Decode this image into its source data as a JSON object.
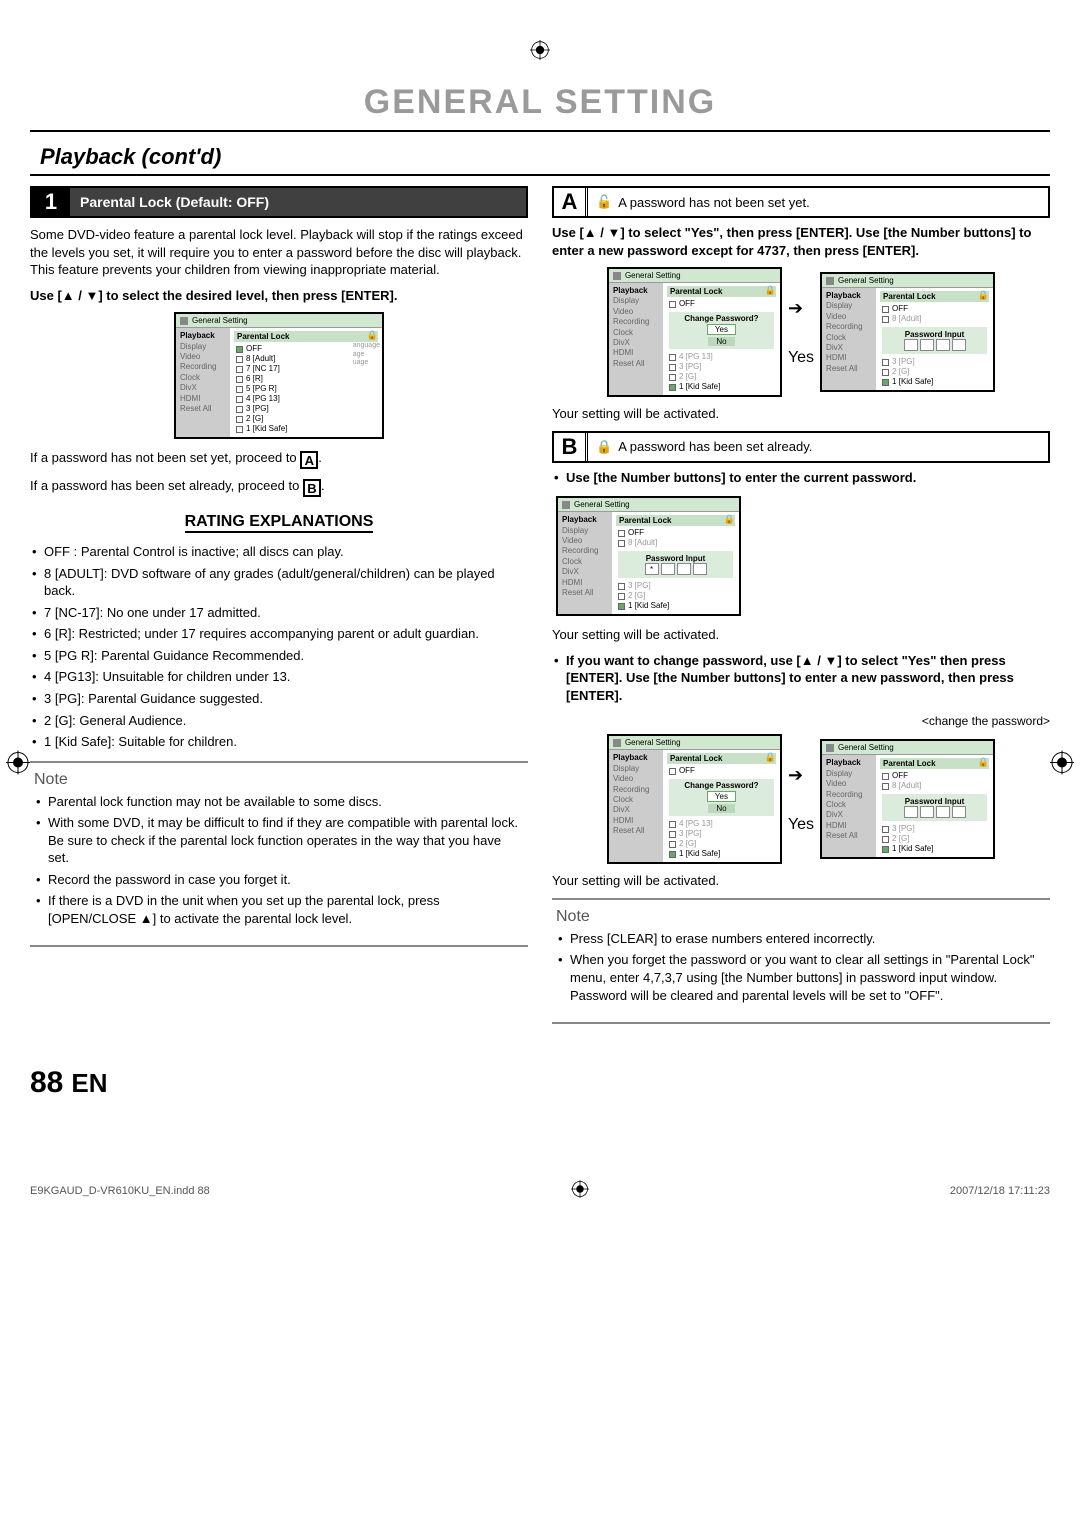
{
  "page": {
    "title": "GENERAL SETTING",
    "section": "Playback (cont'd)",
    "page_number": "88",
    "lang": "EN"
  },
  "step1": {
    "num": "1",
    "title": "Parental Lock (Default: OFF)",
    "intro": "Some DVD-video feature a parental lock level. Playback will stop if the ratings exceed the levels you set, it will require you to enter a password before the disc will playback. This feature prevents your children from viewing inappropriate material.",
    "instr": "Use [▲ / ▼] to select the desired level, then press [ENTER].",
    "after1": "If a password has not been set yet, proceed to ",
    "after1_box": "A",
    "after1_end": ".",
    "after2": "If a password has been set already, proceed to ",
    "after2_box": "B",
    "after2_end": "."
  },
  "osd_common": {
    "title": "General Setting",
    "sidebar": [
      "Playback",
      "Display",
      "Video",
      "Recording",
      "Clock",
      "DivX",
      "HDMI",
      "Reset All"
    ],
    "panel_head": "Parental Lock",
    "levels": [
      "OFF",
      "8 [Adult]",
      "7 [NC 17]",
      "6 [R]",
      "5 [PG R]",
      "4 [PG 13]",
      "3 [PG]",
      "2 [G]",
      "1 [Kid Safe]"
    ],
    "right_hints": [
      "anguage",
      "age",
      "uage"
    ],
    "change_pw": "Change Password?",
    "yes": "Yes",
    "no": "No",
    "pw_input": "Password Input",
    "star": "*"
  },
  "ratings": {
    "title": "RATING EXPLANATIONS",
    "items": [
      "OFF : Parental Control is inactive; all discs can play.",
      "8 [ADULT]: DVD software of any grades (adult/general/children) can be played back.",
      "7 [NC-17]: No one under 17 admitted.",
      "6 [R]: Restricted; under 17 requires accompanying parent or adult guardian.",
      "5 [PG R]: Parental Guidance Recommended.",
      "4 [PG13]: Unsuitable for children under 13.",
      "3 [PG]: Parental Guidance suggested.",
      "2 [G]: General Audience.",
      "1 [Kid Safe]: Suitable for children."
    ]
  },
  "note_left": {
    "heading": "Note",
    "items": [
      "Parental lock function may not be available to some discs.",
      "With some DVD, it may be difficult to find if they are compatible with parental lock. Be sure to check if the parental lock function operates in the way that you have set.",
      "Record the password in case you forget it.",
      "If there is a DVD in the unit when you set up the parental lock, press [OPEN/CLOSE ▲] to activate the parental lock level."
    ]
  },
  "boxA": {
    "letter": "A",
    "text": "A password has not been set yet.",
    "instr": "Use [▲ / ▼] to select \"Yes\", then press [ENTER]. Use [the Number buttons] to enter a new password except for 4737, then press [ENTER].",
    "yes_label": "Yes",
    "result": "Your setting will be activated."
  },
  "boxB": {
    "letter": "B",
    "text": "A password has been set already.",
    "b1": "Use [the Number buttons] to enter the current password.",
    "result1": "Your setting will be activated.",
    "b2": "If you want to change password, use [▲ / ▼] to select \"Yes\" then press [ENTER]. Use [the Number buttons] to enter a new password, then press [ENTER].",
    "caption": "<change the password>",
    "yes_label": "Yes",
    "result2": "Your setting will be activated."
  },
  "note_right": {
    "heading": "Note",
    "items": [
      "Press [CLEAR] to erase numbers entered incorrectly.",
      "When you forget the password or you want to clear all settings in \"Parental Lock\" menu, enter 4,7,3,7 using [the Number buttons] in password input window. Password will be cleared and parental levels will be set to \"OFF\"."
    ]
  },
  "footer": {
    "file": "E9KGAUD_D-VR610KU_EN.indd   88",
    "date": "2007/12/18   17:11:23"
  }
}
